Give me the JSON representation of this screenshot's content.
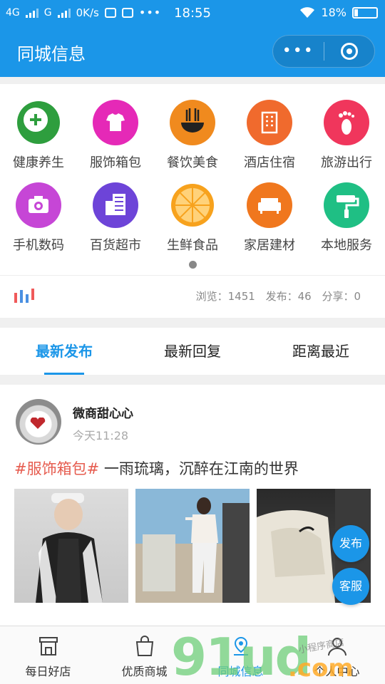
{
  "status_bar": {
    "signal1": "4G",
    "signal2": "G",
    "speed": "0K/s",
    "more": "•••",
    "time": "18:55",
    "battery": "18%"
  },
  "navbar": {
    "title": "同城信息",
    "more_label": "•••"
  },
  "categories": [
    {
      "label": "健康养生",
      "icon": "health-plus-icon",
      "color": "#2e9e3e"
    },
    {
      "label": "服饰箱包",
      "icon": "tshirt-icon",
      "color": "#e529b7"
    },
    {
      "label": "餐饮美食",
      "icon": "noodle-bowl-icon",
      "color": "#f08a1e"
    },
    {
      "label": "酒店住宿",
      "icon": "hotel-icon",
      "color": "#f06a2d"
    },
    {
      "label": "旅游出行",
      "icon": "footprint-icon",
      "color": "#f0365c"
    },
    {
      "label": "手机数码",
      "icon": "camera-icon",
      "color": "#c646d6"
    },
    {
      "label": "百货超市",
      "icon": "building-icon",
      "color": "#6d44d8"
    },
    {
      "label": "生鲜食品",
      "icon": "orange-icon",
      "color": "#f7a21d"
    },
    {
      "label": "家居建材",
      "icon": "sofa-icon",
      "color": "#f0771e"
    },
    {
      "label": "本地服务",
      "icon": "paint-roller-icon",
      "color": "#1fbf84"
    }
  ],
  "stats": {
    "views": "浏览：1451",
    "posts": "发布：46",
    "shares": "分享：0"
  },
  "tabs": [
    {
      "label": "最新发布",
      "active": true
    },
    {
      "label": "最新回复",
      "active": false
    },
    {
      "label": "距离最近",
      "active": false
    }
  ],
  "post": {
    "author": "微商甜心心",
    "time": "今天11:28",
    "tag": "#服饰箱包#",
    "text": " 一雨琉璃，沉醉在江南的世界"
  },
  "fab": {
    "publish": "发布",
    "service": "客服"
  },
  "bottom_nav": [
    {
      "label": "每日好店",
      "icon": "shop-icon"
    },
    {
      "label": "优质商城",
      "icon": "shopping-bag-icon"
    },
    {
      "label": "同城信息",
      "icon": "location-icon",
      "active": true
    },
    {
      "label": "个人中心",
      "icon": "user-icon"
    }
  ],
  "watermark": {
    "main": "91ud",
    "suffix": ".com",
    "small": "小程序商店"
  },
  "colors": {
    "primary": "#1b96e8",
    "tag_red": "#e65c4f"
  }
}
